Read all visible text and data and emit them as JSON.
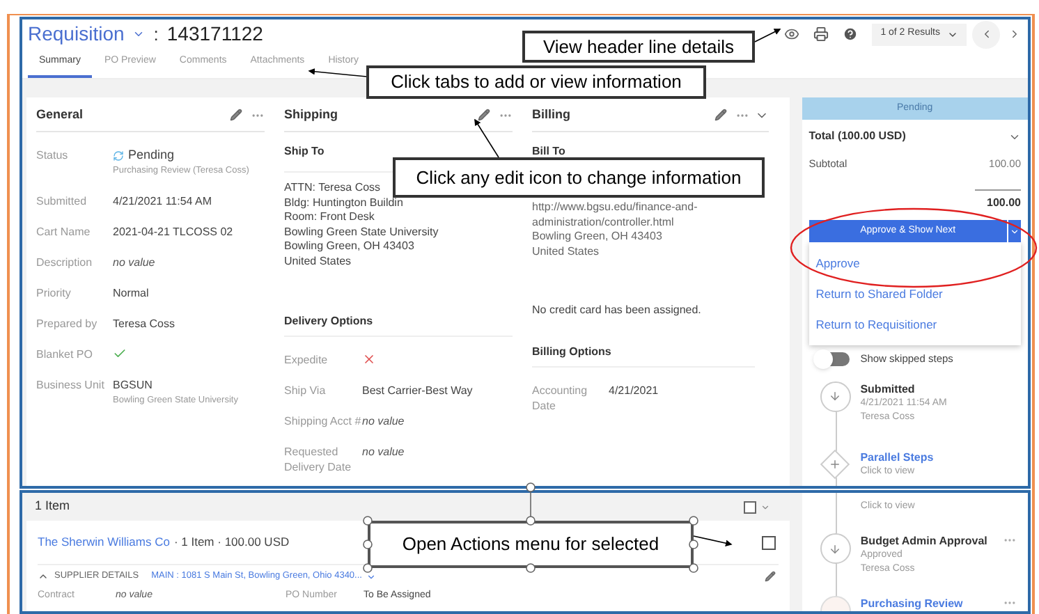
{
  "header": {
    "doc_type": "Requisition",
    "separator": ":",
    "number": "143171122",
    "results": "1 of 2 Results"
  },
  "tabs": [
    {
      "label": "Summary",
      "selected": true
    },
    {
      "label": "PO Preview",
      "selected": false
    },
    {
      "label": "Comments",
      "selected": false
    },
    {
      "label": "Attachments",
      "selected": false
    },
    {
      "label": "History",
      "selected": false
    }
  ],
  "general": {
    "title": "General",
    "fields": [
      {
        "label": "Status",
        "kind": "status",
        "value": "Pending",
        "sub": "Purchasing Review (Teresa Coss)"
      },
      {
        "label": "Submitted",
        "kind": "text",
        "value": "4/21/2021 11:54 AM"
      },
      {
        "label": "Cart Name",
        "kind": "text",
        "value": "2021-04-21 TLCOSS 02"
      },
      {
        "label": "Description",
        "kind": "empty",
        "value": "no value"
      },
      {
        "label": "Priority",
        "kind": "text",
        "value": "Normal"
      },
      {
        "label": "Prepared by",
        "kind": "text",
        "value": "Teresa Coss"
      },
      {
        "label": "Blanket PO",
        "kind": "check",
        "checked": true
      },
      {
        "label": "Business Unit",
        "kind": "text",
        "value": "BGSUN",
        "sub": "Bowling Green State University"
      }
    ]
  },
  "shipping": {
    "title": "Shipping",
    "ship_to_title": "Ship To",
    "address": [
      "ATTN: Teresa Coss",
      "Bldg: Huntington Buildin",
      "Room: Front Desk",
      "Bowling Green State University",
      "Bowling Green, OH 43403",
      "United States"
    ],
    "delivery_title": "Delivery Options",
    "fields": [
      {
        "label": "Expedite",
        "kind": "check",
        "checked": false
      },
      {
        "label": "Ship Via",
        "kind": "text",
        "value": "Best Carrier-Best Way"
      },
      {
        "label": "Shipping Acct #",
        "kind": "empty",
        "value": "no value"
      },
      {
        "label": "Requested Delivery Date",
        "kind": "empty",
        "value": "no value"
      }
    ]
  },
  "billing": {
    "title": "Billing",
    "bill_to_title": "Bill To",
    "address": [
      "http://www.bgsu.edu/finance-and-administration/controller.html",
      "Bowling Green, OH 43403",
      "United States"
    ],
    "note": "No credit card has been assigned.",
    "options_title": "Billing Options",
    "fields": [
      {
        "label": "Accounting Date",
        "kind": "text",
        "value": "4/21/2021"
      }
    ]
  },
  "summary": {
    "status": "Pending",
    "total_label": "Total (100.00 USD)",
    "subtotal_label": "Subtotal",
    "subtotal": "100.00",
    "total": "100.00",
    "primary_action": "Approve & Show Next",
    "menu": [
      "Approve",
      "Return to Shared Folder",
      "Return to Requisitioner"
    ],
    "skipped_toggle": {
      "label": "Show skipped steps",
      "on": false
    },
    "steps": [
      {
        "kind": "arrow",
        "title": "Submitted",
        "lines": [
          "4/21/2021 11:54 AM",
          "Teresa Coss"
        ],
        "link": false
      },
      {
        "kind": "parallel",
        "title": "Parallel Steps",
        "lines": [
          "Click to view"
        ],
        "link": true
      }
    ]
  },
  "items": {
    "title": "1 Item",
    "select_all_checked": false,
    "item_checked": false,
    "supplier": "The Sherwin Williams Co",
    "supplier_summary": "· 1 Item · 100.00 USD",
    "details_label": "SUPPLIER DETAILS",
    "supplier_address": "MAIN : 1081 S Main St, Bowling Green, Ohio 4340...",
    "fields": [
      {
        "label": "Contract",
        "kind": "empty",
        "value": "no value"
      },
      {
        "label": "PO Number",
        "kind": "text",
        "value": "To Be Assigned"
      }
    ]
  },
  "more_steps": [
    {
      "kind": "parallel_tail",
      "lines": [
        "Click to view"
      ]
    },
    {
      "kind": "arrow",
      "title": "Budget Admin Approval",
      "lines": [
        "Approved",
        "Teresa Coss"
      ],
      "link": false
    },
    {
      "kind": "circle",
      "title": "Purchasing Review",
      "link": true
    }
  ],
  "callouts": [
    "View header line details",
    "Click tabs to add or view information",
    "Click any edit icon to change information",
    "Open Actions menu for selected"
  ]
}
